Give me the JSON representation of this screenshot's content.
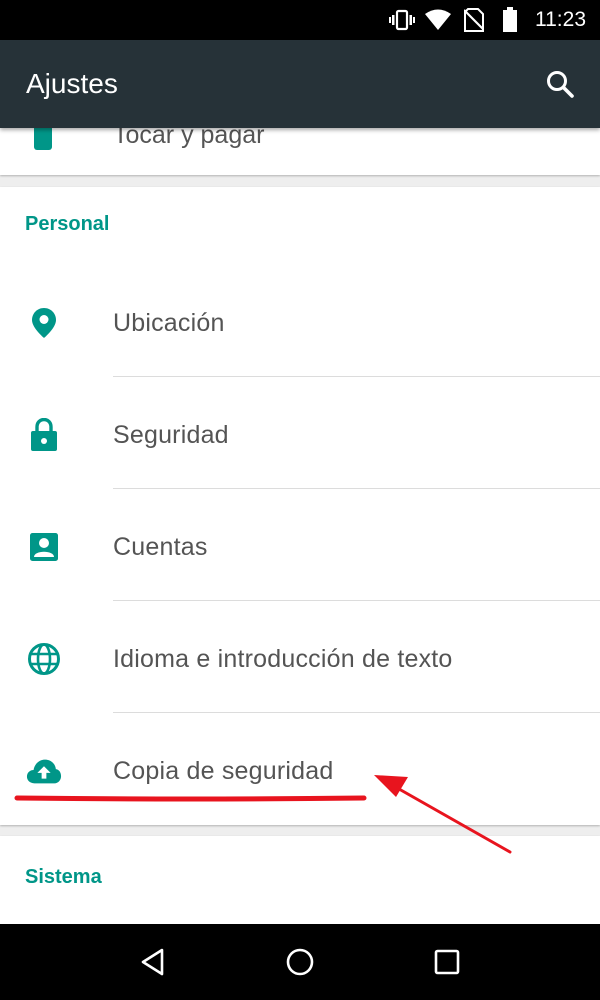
{
  "status_bar": {
    "time": "11:23",
    "icons": [
      "vibrate-icon",
      "wifi-icon",
      "no-sim-icon",
      "battery-icon"
    ]
  },
  "app_bar": {
    "title": "Ajustes",
    "search_icon": "search-icon"
  },
  "top_card": {
    "partial_item_label": "Tocar y pagar",
    "partial_item_icon": "tap-pay-icon"
  },
  "personal": {
    "header": "Personal",
    "items": [
      {
        "label": "Ubicación",
        "icon": "location-icon"
      },
      {
        "label": "Seguridad",
        "icon": "lock-icon"
      },
      {
        "label": "Cuentas",
        "icon": "account-box-icon"
      },
      {
        "label": "Idioma e introducción de texto",
        "icon": "globe-icon"
      },
      {
        "label": "Copia de seguridad",
        "icon": "cloud-upload-icon"
      }
    ]
  },
  "sistema": {
    "header": "Sistema"
  },
  "nav_bar": {
    "buttons": [
      "back-icon",
      "home-icon",
      "recents-icon"
    ]
  },
  "colors": {
    "accent": "#009688",
    "appbar": "#263238",
    "annotation": "#e8141e"
  }
}
